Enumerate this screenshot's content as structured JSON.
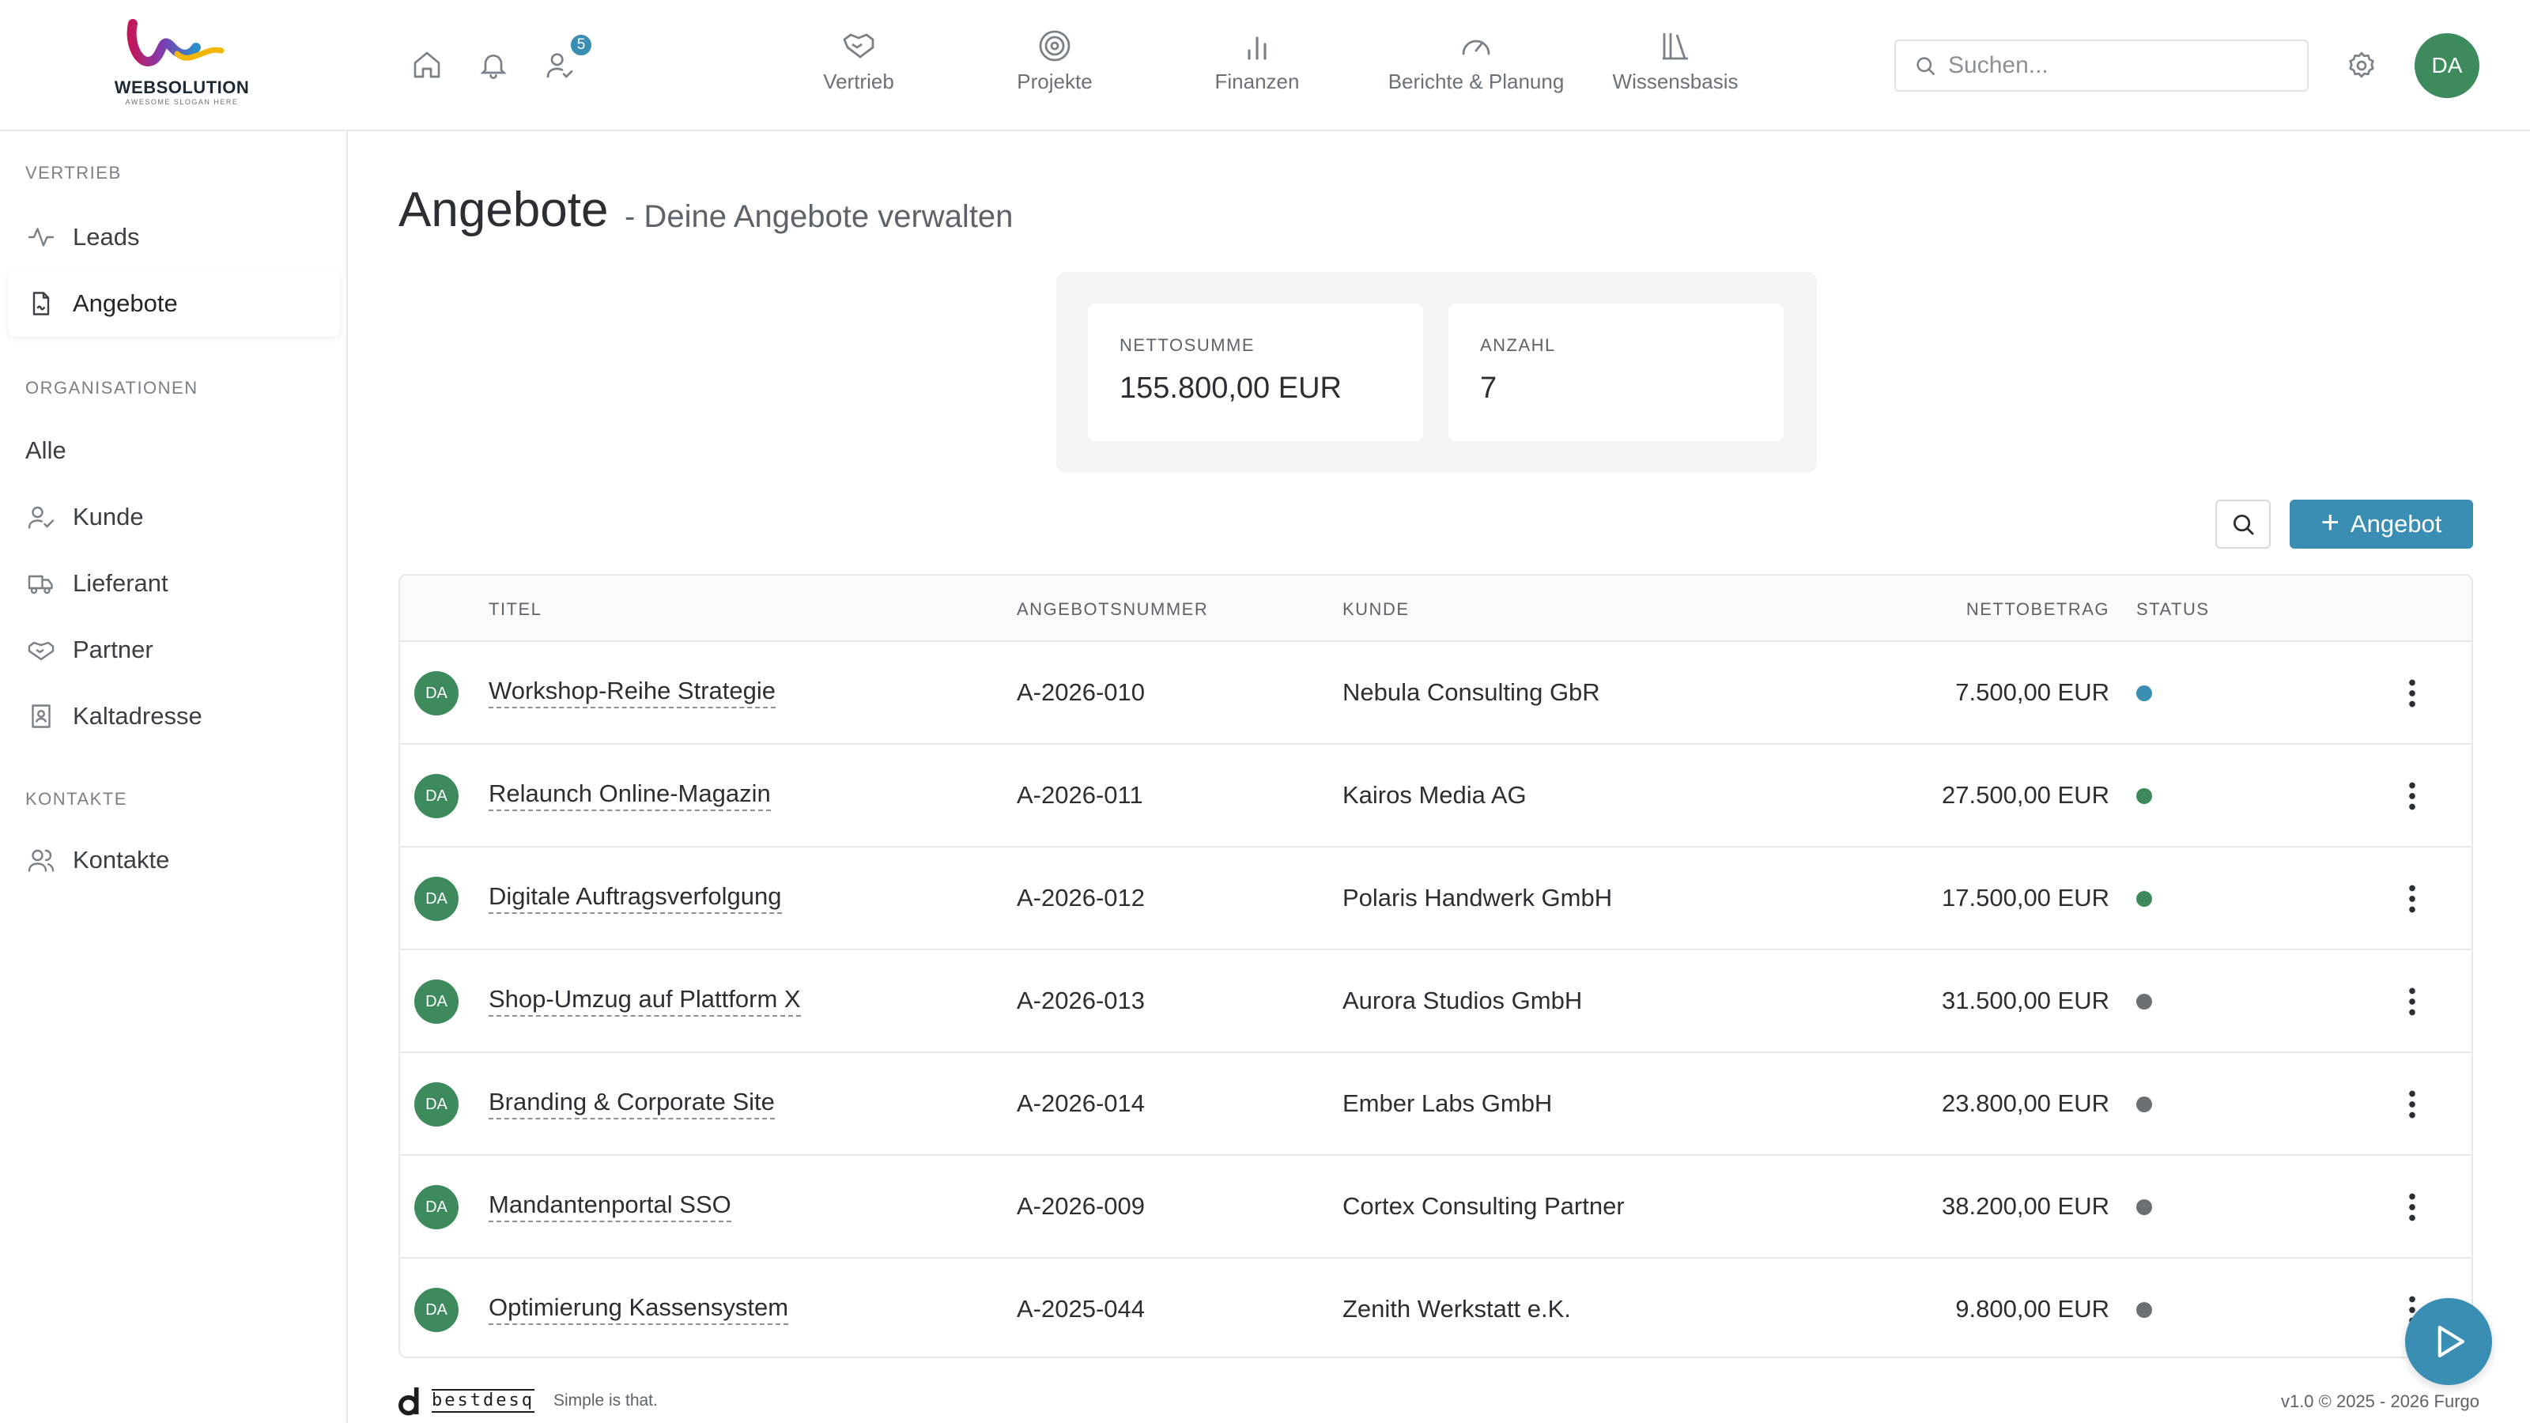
{
  "brand": {
    "name_bold": "WEB",
    "name_rest": "SOLUTION",
    "slogan": "AWESOME SLOGAN HERE"
  },
  "header": {
    "notification_count": "5",
    "nav": [
      {
        "label": "Vertrieb",
        "icon": "handshake-icon"
      },
      {
        "label": "Projekte",
        "icon": "target-icon"
      },
      {
        "label": "Finanzen",
        "icon": "bar-chart-icon"
      },
      {
        "label": "Berichte & Planung",
        "icon": "gauge-icon"
      },
      {
        "label": "Wissensbasis",
        "icon": "library-icon"
      }
    ],
    "search_placeholder": "Suchen...",
    "user_initials": "DA"
  },
  "sidebar": {
    "sections": [
      {
        "title": "VERTRIEB",
        "items": [
          {
            "label": "Leads",
            "icon": "activity-icon"
          },
          {
            "label": "Angebote",
            "icon": "file-sign-icon",
            "active": true
          }
        ]
      },
      {
        "title": "ORGANISATIONEN",
        "items": [
          {
            "label": "Alle",
            "icon": ""
          },
          {
            "label": "Kunde",
            "icon": "user-check-icon"
          },
          {
            "label": "Lieferant",
            "icon": "truck-icon"
          },
          {
            "label": "Partner",
            "icon": "handshake-icon"
          },
          {
            "label": "Kaltadresse",
            "icon": "contact-book-icon"
          }
        ]
      },
      {
        "title": "KONTAKTE",
        "items": [
          {
            "label": "Kontakte",
            "icon": "users-icon"
          }
        ]
      }
    ]
  },
  "page": {
    "title": "Angebote",
    "subtitle": "- Deine Angebote verwalten",
    "add_button": "Angebot"
  },
  "stats": [
    {
      "label": "NETTOSUMME",
      "value": "155.800,00 EUR"
    },
    {
      "label": "ANZAHL",
      "value": "7"
    }
  ],
  "table": {
    "columns": [
      "TITEL",
      "ANGEBOTSNUMMER",
      "KUNDE",
      "NETTOBETRAG",
      "STATUS"
    ],
    "rows": [
      {
        "owner": "DA",
        "title": "Workshop-Reihe Strategie",
        "number": "A-2026-010",
        "customer": "Nebula Consulting GbR",
        "amount": "7.500,00 EUR",
        "status_color": "#3a8db3"
      },
      {
        "owner": "DA",
        "title": "Relaunch Online-Magazin",
        "number": "A-2026-011",
        "customer": "Kairos Media AG",
        "amount": "27.500,00 EUR",
        "status_color": "#3d8a5c"
      },
      {
        "owner": "DA",
        "title": "Digitale Auftragsverfolgung",
        "number": "A-2026-012",
        "customer": "Polaris Handwerk GmbH",
        "amount": "17.500,00 EUR",
        "status_color": "#3d8a5c"
      },
      {
        "owner": "DA",
        "title": "Shop-Umzug auf Plattform X",
        "number": "A-2026-013",
        "customer": "Aurora Studios GmbH",
        "amount": "31.500,00 EUR",
        "status_color": "#6b7075"
      },
      {
        "owner": "DA",
        "title": "Branding & Corporate Site",
        "number": "A-2026-014",
        "customer": "Ember Labs GmbH",
        "amount": "23.800,00 EUR",
        "status_color": "#6b7075"
      },
      {
        "owner": "DA",
        "title": "Mandantenportal SSO",
        "number": "A-2026-009",
        "customer": "Cortex Consulting Partner",
        "amount": "38.200,00 EUR",
        "status_color": "#6b7075"
      },
      {
        "owner": "DA",
        "title": "Optimierung Kassensystem",
        "number": "A-2025-044",
        "customer": "Zenith Werkstatt e.K.",
        "amount": "9.800,00 EUR",
        "status_color": "#6b7075"
      }
    ]
  },
  "footer": {
    "brand": "bestdesq",
    "slogan": "Simple is that.",
    "version": "v1.0 © 2025 - 2026 Furgo"
  },
  "colors": {
    "accent": "#3a8db3",
    "success": "#3d8a5c",
    "neutral": "#6b7075"
  }
}
